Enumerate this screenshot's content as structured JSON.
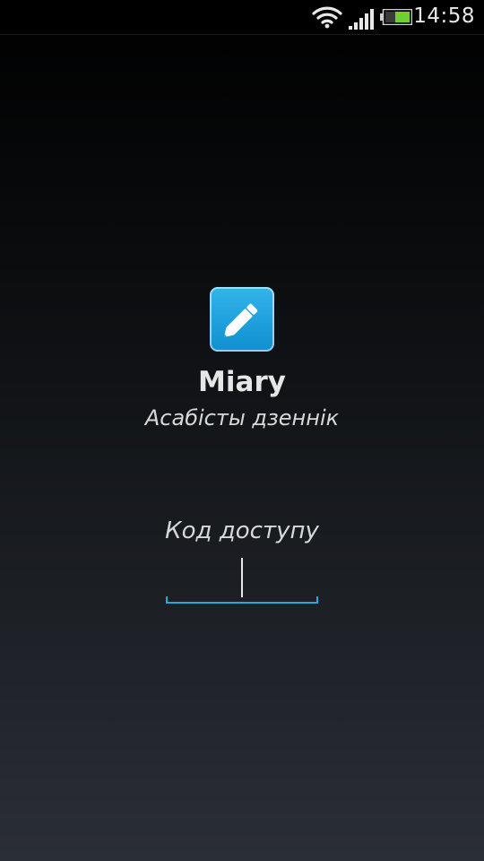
{
  "status_bar": {
    "time": "14:58",
    "wifi_icon": "wifi-icon",
    "signal_icon": "signal-icon",
    "battery_icon": "battery-icon"
  },
  "app": {
    "icon": "pencil-icon",
    "name": "Miary",
    "subtitle": "Асабісты дзеннік"
  },
  "passcode": {
    "label": "Код доступу",
    "value": ""
  },
  "colors": {
    "accent": "#2aa6dd",
    "icon_background": "#1ea0dc",
    "battery_fill": "#6fd12b"
  }
}
